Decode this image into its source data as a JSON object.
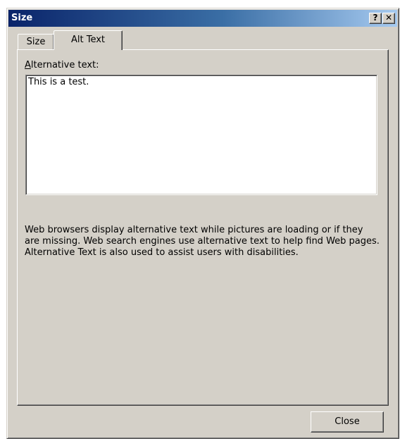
{
  "window": {
    "title": "Size",
    "help_label": "?",
    "close_label": "✕"
  },
  "tabs": [
    {
      "label": "Size",
      "selected": false
    },
    {
      "label": "Alt Text",
      "selected": true
    }
  ],
  "alt_text": {
    "label_mnemonic": "A",
    "label_rest": "lternative text:",
    "value": "This is a test.",
    "description": "Web browsers display alternative text while pictures are loading or if they are missing.  Web search engines use alternative text to help find Web pages.  Alternative Text is also used to assist users with disabilities."
  },
  "buttons": {
    "close_label": "Close"
  },
  "colors": {
    "face": "#d4d0c8",
    "title_start": "#0a246a",
    "title_end": "#a6caf0",
    "input_bg": "#ffffff"
  }
}
